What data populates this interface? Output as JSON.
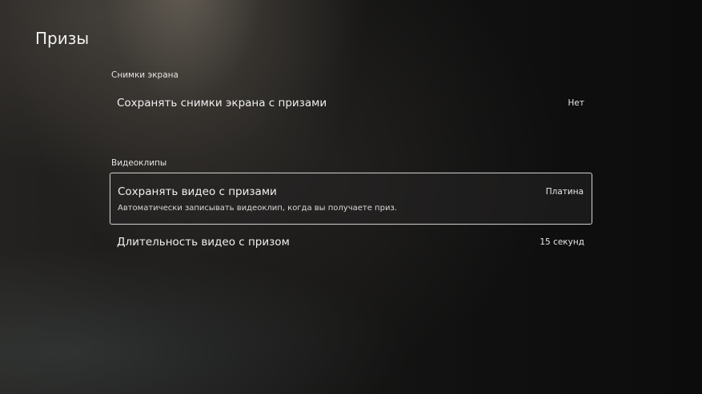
{
  "page": {
    "title": "Призы"
  },
  "sections": [
    {
      "header": "Снимки экрана",
      "items": [
        {
          "label": "Сохранять снимки экрана с призами",
          "value": "Нет"
        }
      ]
    },
    {
      "header": "Видеоклипы",
      "items": [
        {
          "label": "Сохранять видео с призами",
          "value": "Платина",
          "description": "Автоматически записывать видеоклип, когда вы получаете приз.",
          "focused": true
        },
        {
          "label": "Длительность видео с призом",
          "value": "15 секунд"
        }
      ]
    }
  ]
}
